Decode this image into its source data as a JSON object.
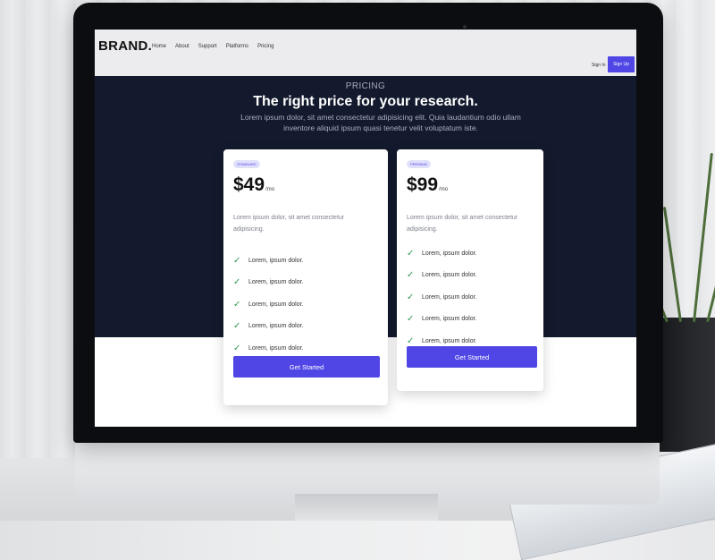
{
  "nav": {
    "brand": "BRAND.",
    "links": [
      "Home",
      "About",
      "Support",
      "Platforms",
      "Pricing"
    ],
    "sign_in": "Sign In",
    "sign_up": "Sign Up"
  },
  "hero": {
    "eyebrow": "PRICING",
    "title": "The right price for your research.",
    "subtitle": "Lorem ipsum dolor, sit amet consectetur adipisicing elit. Quia laudantium odio ullam inventore aliquid ipsum quasi tenetur velit voluptatum iste."
  },
  "plans": [
    {
      "badge": "STANDARD",
      "price": "$49",
      "period": "/mo",
      "description": "Lorem ipsum dolor, sit amet consectetur adipisicing.",
      "features": [
        "Lorem, ipsum dolor.",
        "Lorem, ipsum dolor.",
        "Lorem, ipsum dolor.",
        "Lorem, ipsum dolor.",
        "Lorem, ipsum dolor."
      ],
      "cta": "Get Started"
    },
    {
      "badge": "PREMIUM",
      "price": "$99",
      "period": "/mo",
      "description": "Lorem ipsum dolor, sit amet consectetur adipisicing.",
      "features": [
        "Lorem, ipsum dolor.",
        "Lorem, ipsum dolor.",
        "Lorem, ipsum dolor.",
        "Lorem, ipsum dolor.",
        "Lorem, ipsum dolor."
      ],
      "cta": "Get Started"
    }
  ],
  "colors": {
    "accent": "#4f46e5",
    "hero_bg": "#131a2d",
    "check": "#2f9a52",
    "nav_bg": "#ececee"
  }
}
